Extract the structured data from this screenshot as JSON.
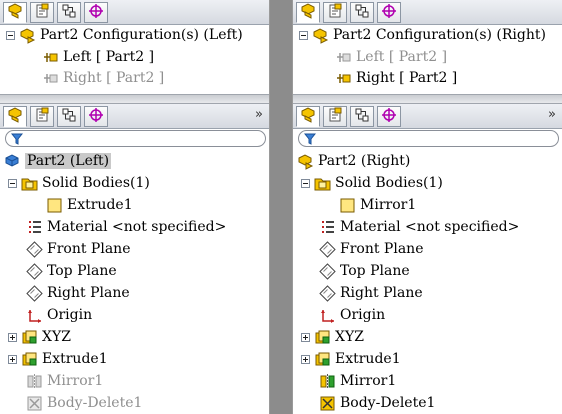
{
  "left": {
    "config_title": "Part2 Configuration(s)  (Left)",
    "configs": [
      {
        "label": "Left [ Part2 ]",
        "active": true
      },
      {
        "label": "Right [ Part2 ]",
        "active": false
      }
    ],
    "root": "Part2  (Left)",
    "solid_bodies": "Solid Bodies(1)",
    "body": "Extrude1",
    "material": "Material <not specified>",
    "front_plane": "Front Plane",
    "top_plane": "Top Plane",
    "right_plane": "Right Plane",
    "origin": "Origin",
    "xyz": "XYZ",
    "extrude": "Extrude1",
    "mirror": "Mirror1",
    "body_delete": "Body-Delete1"
  },
  "right": {
    "config_title": "Part2 Configuration(s)  (Right)",
    "configs": [
      {
        "label": "Left [ Part2 ]",
        "active": false
      },
      {
        "label": "Right [ Part2 ]",
        "active": true
      }
    ],
    "root": "Part2  (Right)",
    "solid_bodies": "Solid Bodies(1)",
    "body": "Mirror1",
    "material": "Material <not specified>",
    "front_plane": "Front Plane",
    "top_plane": "Top Plane",
    "right_plane": "Right Plane",
    "origin": "Origin",
    "xyz": "XYZ",
    "extrude": "Extrude1",
    "mirror": "Mirror1",
    "body_delete": "Body-Delete1"
  },
  "overflow_chevron": "»",
  "colors": {
    "selection": "#c9c9c9",
    "suppressed_text": "#8f8f8f",
    "folder": "#f5c400",
    "tab_accent": "#b000b0"
  }
}
